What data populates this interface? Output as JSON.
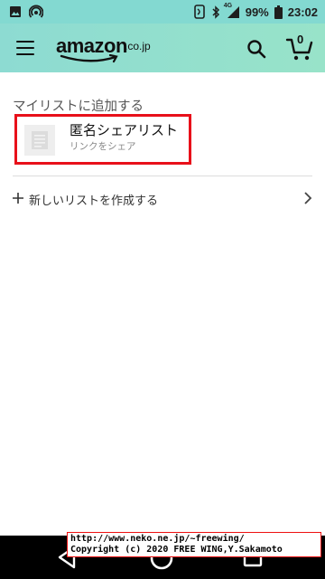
{
  "status_bar": {
    "battery_percent": "99%",
    "time": "23:02",
    "network_label": "4G"
  },
  "header": {
    "logo_text": "amazon",
    "logo_suffix": ".co.jp",
    "cart_count": "0",
    "icons": [
      "menu-icon",
      "search-icon",
      "cart-icon"
    ]
  },
  "main": {
    "section_heading": "マイリストに追加する",
    "lists": [
      {
        "name": "匿名シェアリスト",
        "subtitle": "リンクをシェア",
        "highlighted": true
      }
    ],
    "create_list_label": "新しいリストを作成する"
  },
  "watermark": {
    "line1": "http://www.neko.ne.jp/~freewing/",
    "line2": "Copyright (c) 2020 FREE WING,Y.Sakamoto"
  },
  "colors": {
    "header_bg": "#8ddbd2",
    "highlight_border": "#e8101a",
    "nav_bg": "#000000"
  }
}
